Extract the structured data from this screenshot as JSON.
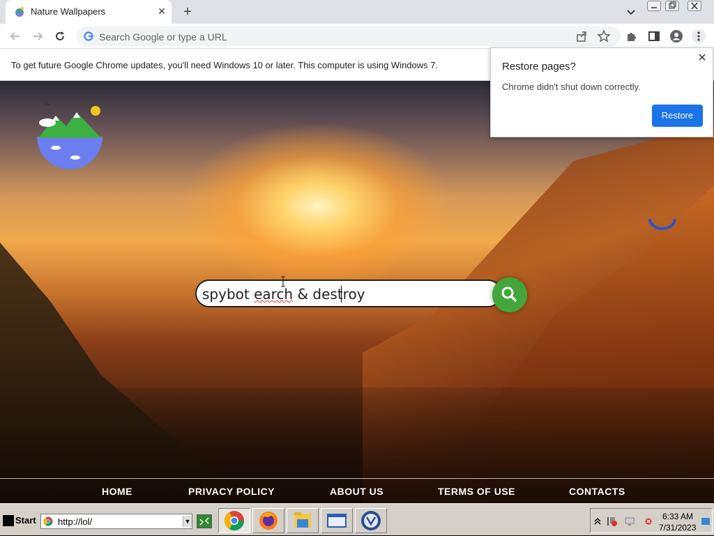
{
  "browser": {
    "tab_title": "Nature Wallpapers",
    "tab_close": "✕",
    "new_tab": "+",
    "omnibox_placeholder": "Search Google or type a URL",
    "infobar_text": "To get future Google Chrome updates, you'll need Windows 10 or later. This computer is using Windows 7."
  },
  "restore_popup": {
    "title": "Restore pages?",
    "message": "Chrome didn't shut down correctly.",
    "button": "Restore",
    "close": "✕"
  },
  "page": {
    "search_value_prefix": "spybot ",
    "search_value_misspelled": "earch",
    "search_value_suffix": " & destroy",
    "footer_links": [
      "HOME",
      "PRIVACY POLICY",
      "ABOUT US",
      "TERMS OF USE",
      "CONTACTS"
    ]
  },
  "taskbar": {
    "start_label": "Start",
    "address_text": "http://lol/",
    "time": "6:33 AM",
    "date": "7/31/2023",
    "apps": [
      "chrome-icon",
      "firefox-icon",
      "file-explorer-icon",
      "window-icon",
      "spybot-icon"
    ]
  },
  "colors": {
    "restore_button": "#1a73e8",
    "search_button": "#43a63a"
  }
}
